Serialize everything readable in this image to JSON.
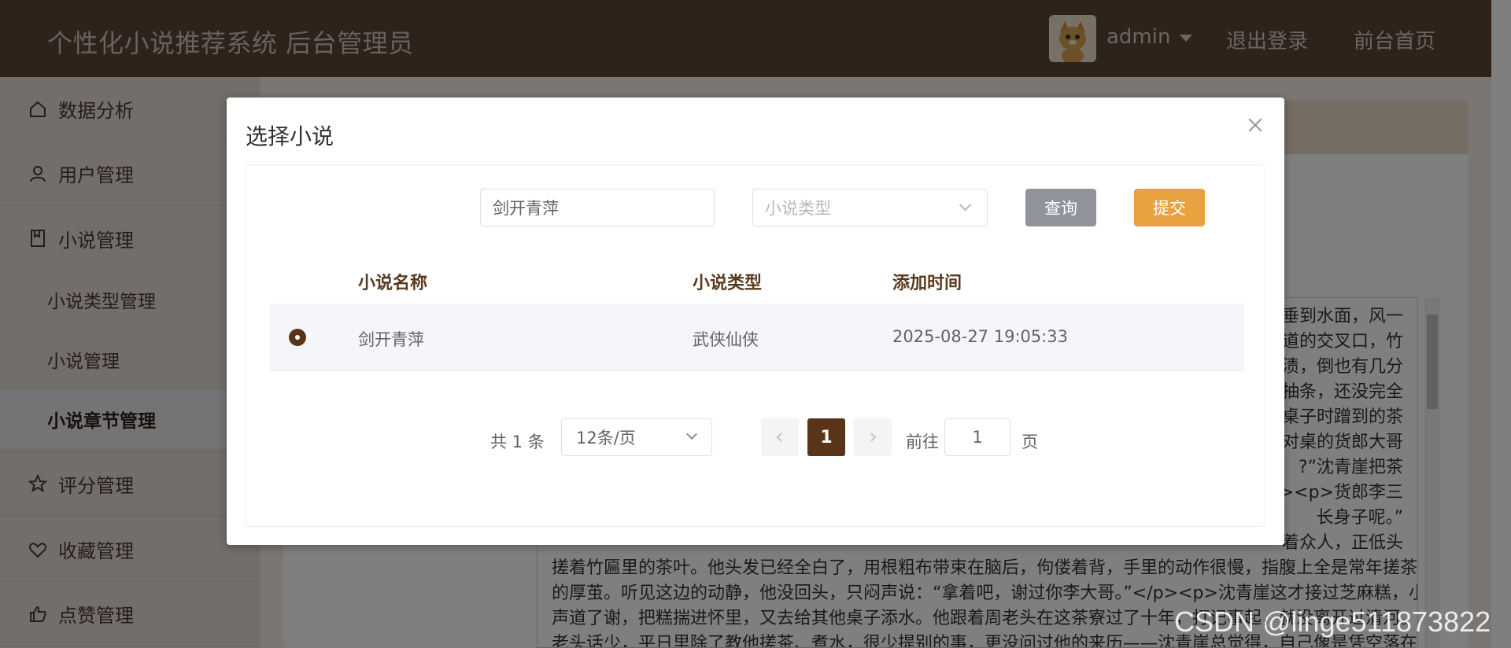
{
  "header": {
    "title": "个性化小说推荐系统 后台管理员",
    "user": "admin",
    "logout": "退出登录",
    "home": "前台首页"
  },
  "sidebar": {
    "items": [
      {
        "label": "数据分析",
        "icon": "home-icon"
      },
      {
        "label": "用户管理",
        "icon": "user-icon"
      },
      {
        "label": "小说管理",
        "icon": "book-icon"
      },
      {
        "label": "评分管理",
        "icon": "star-icon"
      },
      {
        "label": "收藏管理",
        "icon": "heart-icon"
      },
      {
        "label": "点赞管理",
        "icon": "thumbs-up-icon"
      }
    ],
    "sub_items": [
      {
        "label": "小说类型管理"
      },
      {
        "label": "小说管理"
      },
      {
        "label": "小说章节管理",
        "active": true
      }
    ]
  },
  "editor": {
    "lines": [
      "垂到水面，风一",
      "官道的交叉口，竹",
      "茶渍，倒也有几分",
      "抽条，还没完全",
      "擦桌子时蹭到的茶",
      "。对桌的货郎大哥",
      "?”沈青崖把茶",
      "p><p>货郎李三",
      "长身子呢。”",
      "着众人，正低头",
      "搓着竹匾里的茶叶。他头发已经全白了，用根粗布带束在脑后，佝偻着背，手里的动作很慢，指腹上全是常年搓茶磨出",
      "的厚茧。听见这边的动静，他没回头，只闷声说：“拿着吧，谢过你李大哥。”</p><p>沈青崖这才接过芝麻糕，小",
      "声道了谢，把糕揣进怀里，又去给其他桌子添水。他跟着周老头在这茶寮过了十年，打记事起，就没离开过清河。周",
      "老头话少，平日里除了教他搓茶、煮水，很少提别的事，更没问过他的来历——沈青崖总觉得，自己像是凭空落在这茶"
    ]
  },
  "dialog": {
    "title": "选择小说",
    "search_value": "剑开青萍",
    "type_placeholder": "小说类型",
    "query_label": "查询",
    "submit_label": "提交",
    "columns": [
      "小说名称",
      "小说类型",
      "添加时间"
    ],
    "rows": [
      {
        "name": "剑开青萍",
        "type": "武侠仙侠",
        "time": "2025-08-27 19:05:33",
        "selected": true
      }
    ],
    "pagination": {
      "total": "共 1 条",
      "page_size": "12条/页",
      "current": "1",
      "goto_label": "前往",
      "goto_value": "1",
      "page_suffix": "页"
    }
  },
  "watermark": "CSDN @linge511873822"
}
